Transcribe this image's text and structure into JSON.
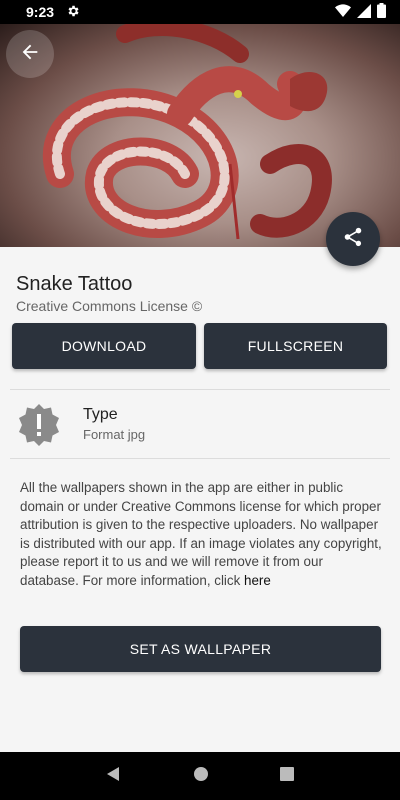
{
  "status_bar": {
    "time": "9:23"
  },
  "item": {
    "title": "Snake Tattoo",
    "license": "Creative Commons License ©"
  },
  "actions": {
    "download": "DOWNLOAD",
    "fullscreen": "FULLSCREEN",
    "set_wallpaper": "SET AS WALLPAPER"
  },
  "type_info": {
    "label": "Type",
    "value": "Format jpg",
    "icon": "alert-badge-icon"
  },
  "disclaimer": {
    "text": "All the wallpapers shown in the app are either in public domain or under Creative Commons license for which proper attribution is given to the respective uploaders. No wallpaper is distributed with our app. If an image violates any copyright, please report it to us and we will remove it from our database. For more information, click ",
    "link": "here"
  },
  "colors": {
    "button": "#2b323c",
    "background": "#f5f5f5"
  }
}
